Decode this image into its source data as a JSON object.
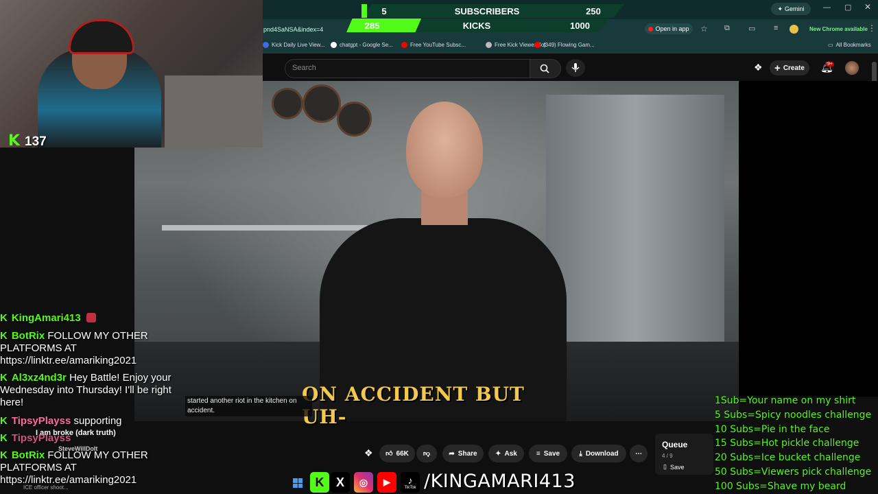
{
  "browser": {
    "url_fragment": "pnd4SaNSA&index=4",
    "gemini_label": "Gemini",
    "open_in_app": "Open in app",
    "new_chrome": "New Chrome available",
    "all_bookmarks": "All Bookmarks",
    "bookmarks": [
      {
        "label": "Kick Daily Live View...",
        "color": "#4169e1"
      },
      {
        "label": "chatgpt - Google Se...",
        "color": "#ffffff"
      },
      {
        "label": "Free YouTube Subsc...",
        "color": "#ff0000"
      },
      {
        "label": "Free Kick Viewer Bot",
        "color": "#000000"
      },
      {
        "label": "Free Kick Viewer Bot",
        "color": "#bbbbbb"
      },
      {
        "label": "(349) Flowing Gam...",
        "color": "#ff0000"
      }
    ]
  },
  "goal_bar": {
    "subs_current": "5",
    "subs_label": "SUBSCRIBERS",
    "subs_target": "250",
    "subs_progress": 0.02,
    "kicks_current": "285",
    "kicks_label": "KICKS",
    "kicks_target": "1000",
    "kicks_progress": 0.285,
    "accent": "#53fc18"
  },
  "youtube": {
    "search_placeholder": "Search",
    "create_label": "Create",
    "notif_badge": "9+",
    "caption": "started another riot in the kitchen on accident.",
    "subtitle": "ON ACCIDENT BUT UH-",
    "actions": {
      "likes": "66K",
      "share": "Share",
      "ask": "Ask",
      "save": "Save",
      "download": "Download"
    },
    "queue": {
      "title": "Queue",
      "position": "4 / 9",
      "save": "Save"
    }
  },
  "stream": {
    "viewer_count": "137"
  },
  "chat": [
    {
      "user": "KingAmari413",
      "user_color": "#53fc18",
      "text": ""
    },
    {
      "user": "BotRix",
      "user_color": "#53fc18",
      "text": "FOLLOW MY OTHER PLATFORMS AT https://linktr.ee/amariking2021"
    },
    {
      "user": "Al3xz4nd3r",
      "user_color": "#53fc18",
      "text": "Hey Battle! Enjoy your Wednesday into Thursday! I'll be right here!"
    },
    {
      "user": "TipsyPlayss",
      "user_color": "#53fc18",
      "text": "supporting"
    },
    {
      "user": "TipsyPlayss",
      "user_color": "#ff6b9a",
      "text": ""
    },
    {
      "user": "BotRix",
      "user_color": "#53fc18",
      "text": "FOLLOW MY OTHER PLATFORMS AT https://linktr.ee/amariking2021"
    }
  ],
  "chat_overlay": {
    "line1": "I am broke (dark truth)",
    "line2": "SteveWillDoIt",
    "line3": "ICE officer shoot..."
  },
  "goals": [
    "1Sub=Your name on my shirt",
    "5 Subs=Spicy noodles challenge",
    "10 Subs=Pie in the face",
    "15 Subs=Hot pickle challenge",
    "20 Subs=Ice bucket challenge",
    "50 Subs=Viewers pick challenge",
    "100 Subs=Shave my beard"
  ],
  "banner": {
    "handle": "/KINGAMARI413",
    "tiktok_label": "TikTok"
  }
}
